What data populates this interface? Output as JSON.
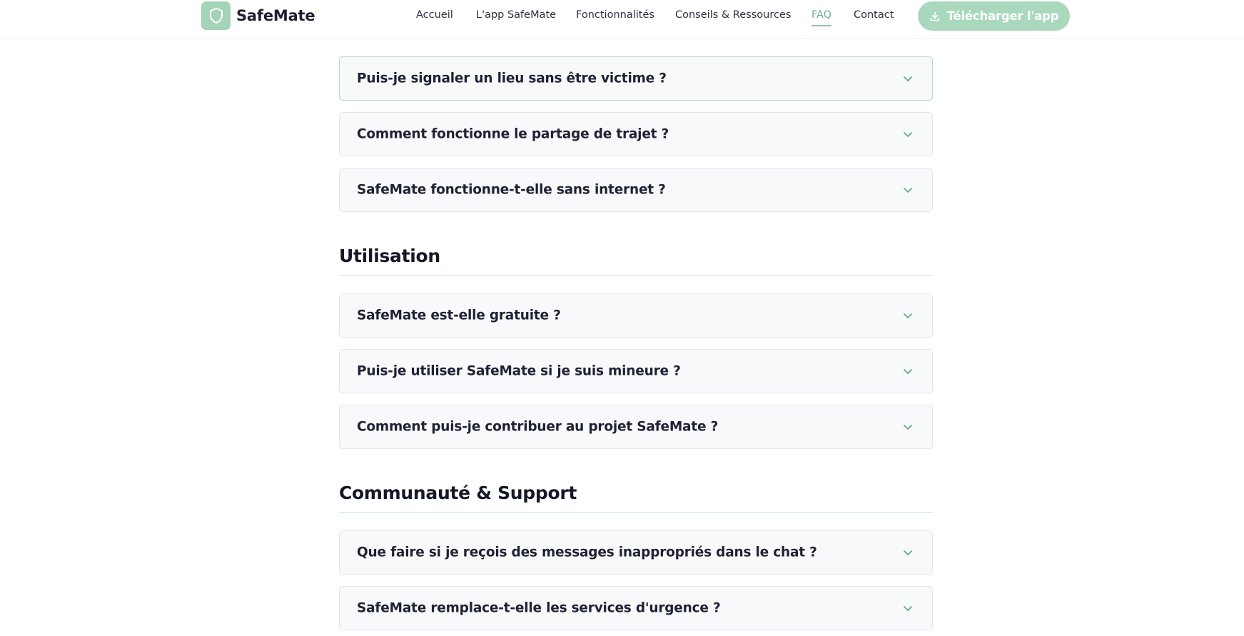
{
  "brand": {
    "name": "SafeMate",
    "accent_color": "#a9d8bc",
    "logo_icon": "shield-icon"
  },
  "nav": {
    "items": [
      {
        "label": "Accueil",
        "active": false
      },
      {
        "label": "L'app SafeMate",
        "active": false
      },
      {
        "label": "Fonctionnalités",
        "active": false
      },
      {
        "label": "Conseils & Ressources",
        "active": false
      },
      {
        "label": "FAQ",
        "active": true
      },
      {
        "label": "Contact",
        "active": false
      }
    ],
    "cta_label": "Télécharger l'app",
    "cta_icon": "download-icon"
  },
  "faq": {
    "top_items": [
      {
        "question": "Puis-je signaler un lieu sans être victime ?"
      },
      {
        "question": "Comment fonctionne le partage de trajet ?"
      },
      {
        "question": "SafeMate fonctionne-t-elle sans internet ?"
      }
    ],
    "sections": [
      {
        "title": "Utilisation",
        "items": [
          {
            "question": "SafeMate est-elle gratuite ?"
          },
          {
            "question": "Puis-je utiliser SafeMate si je suis mineure ?"
          },
          {
            "question": "Comment puis-je contribuer au projet SafeMate ?"
          }
        ]
      },
      {
        "title": "Communauté & Support",
        "items": [
          {
            "question": "Que faire si je reçois des messages inappropriés dans le chat ?"
          },
          {
            "question": "SafeMate remplace-t-elle les services d'urgence ?"
          }
        ]
      }
    ],
    "expand_icon": "chevron-down-icon"
  }
}
